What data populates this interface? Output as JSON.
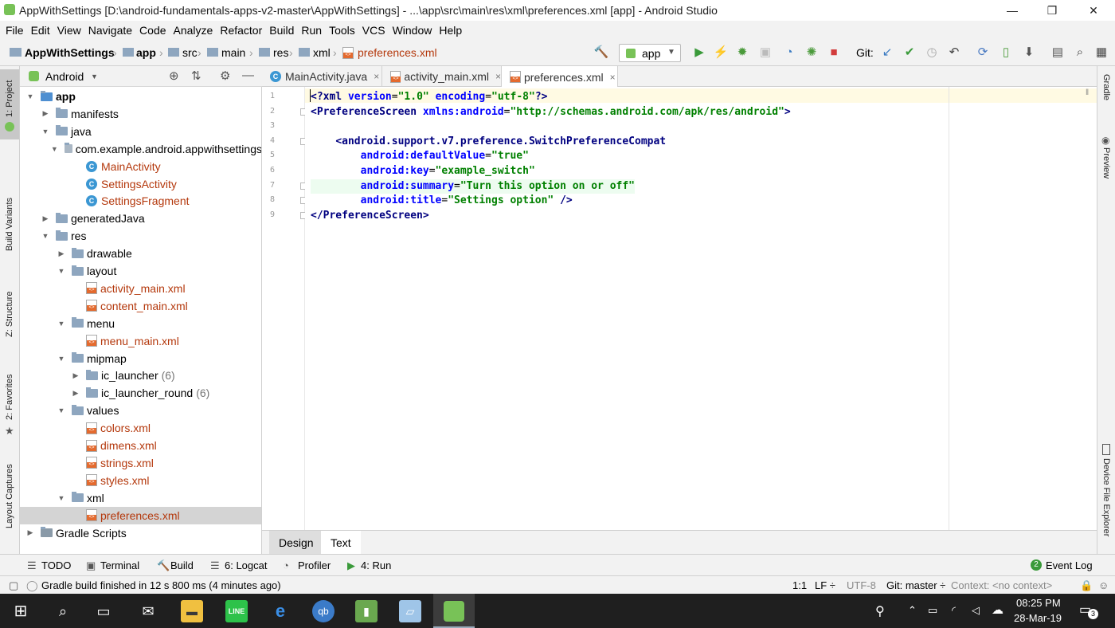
{
  "window": {
    "title": "AppWithSettings [D:\\android-fundamentals-apps-v2-master\\AppWithSettings] - ...\\app\\src\\main\\res\\xml\\preferences.xml [app] - Android Studio",
    "minimize": "—",
    "maximize": "❐",
    "close": "✕"
  },
  "menu": [
    "File",
    "Edit",
    "View",
    "Navigate",
    "Code",
    "Analyze",
    "Refactor",
    "Build",
    "Run",
    "Tools",
    "VCS",
    "Window",
    "Help"
  ],
  "breadcrumbs": [
    "AppWithSettings",
    "app",
    "src",
    "main",
    "res",
    "xml",
    "preferences.xml"
  ],
  "toolbar": {
    "run_config": "app",
    "git_label": "Git:"
  },
  "left_tabs": [
    "1: Project",
    "Build Variants",
    "Z: Structure",
    "2: Favorites",
    "Layout Captures"
  ],
  "right_tabs": [
    "Gradle",
    "Preview",
    "Device File Explorer"
  ],
  "project": {
    "view_label": "Android",
    "tree": [
      {
        "label": "app",
        "kind": "module",
        "level": 0,
        "open": true
      },
      {
        "label": "manifests",
        "kind": "folder",
        "level": 1,
        "open": false
      },
      {
        "label": "java",
        "kind": "folder",
        "level": 1,
        "open": true
      },
      {
        "label": "com.example.android.appwithsettings",
        "kind": "package",
        "level": 2,
        "open": true
      },
      {
        "label": "MainActivity",
        "kind": "class",
        "level": 3
      },
      {
        "label": "SettingsActivity",
        "kind": "class",
        "level": 3
      },
      {
        "label": "SettingsFragment",
        "kind": "class",
        "level": 3
      },
      {
        "label": "generatedJava",
        "kind": "folder",
        "level": 1,
        "open": false
      },
      {
        "label": "res",
        "kind": "folder",
        "level": 1,
        "open": true
      },
      {
        "label": "drawable",
        "kind": "folder",
        "level": 2,
        "open": false
      },
      {
        "label": "layout",
        "kind": "folder",
        "level": 2,
        "open": true
      },
      {
        "label": "activity_main.xml",
        "kind": "xml",
        "level": 3
      },
      {
        "label": "content_main.xml",
        "kind": "xml",
        "level": 3
      },
      {
        "label": "menu",
        "kind": "folder",
        "level": 2,
        "open": true
      },
      {
        "label": "menu_main.xml",
        "kind": "xml",
        "level": 3
      },
      {
        "label": "mipmap",
        "kind": "folder",
        "level": 2,
        "open": true
      },
      {
        "label": "ic_launcher",
        "kind": "folder",
        "level": 3,
        "open": false,
        "count": "(6)"
      },
      {
        "label": "ic_launcher_round",
        "kind": "folder",
        "level": 3,
        "open": false,
        "count": "(6)"
      },
      {
        "label": "values",
        "kind": "folder",
        "level": 2,
        "open": true
      },
      {
        "label": "colors.xml",
        "kind": "xml",
        "level": 3
      },
      {
        "label": "dimens.xml",
        "kind": "xml",
        "level": 3
      },
      {
        "label": "strings.xml",
        "kind": "xml",
        "level": 3
      },
      {
        "label": "styles.xml",
        "kind": "xml",
        "level": 3
      },
      {
        "label": "xml",
        "kind": "folder",
        "level": 2,
        "open": true
      },
      {
        "label": "preferences.xml",
        "kind": "xml",
        "level": 3,
        "selected": true
      },
      {
        "label": "Gradle Scripts",
        "kind": "gradle",
        "level": 0,
        "open": false
      }
    ]
  },
  "editor_tabs": [
    {
      "label": "MainActivity.java",
      "icon": "class",
      "active": false
    },
    {
      "label": "activity_main.xml",
      "icon": "xml",
      "active": false
    },
    {
      "label": "preferences.xml",
      "icon": "xml",
      "active": true
    }
  ],
  "code_lines": [
    {
      "n": "1",
      "tokens": [
        {
          "c": "kw",
          "t": "<?xml "
        },
        {
          "c": "at",
          "t": "version"
        },
        {
          "c": "",
          "t": "="
        },
        {
          "c": "st",
          "t": "\"1.0\""
        },
        {
          "c": "",
          "t": " "
        },
        {
          "c": "at",
          "t": "encoding"
        },
        {
          "c": "",
          "t": "="
        },
        {
          "c": "st",
          "t": "\"utf-8\""
        },
        {
          "c": "kw",
          "t": "?>"
        }
      ]
    },
    {
      "n": "2",
      "tokens": [
        {
          "c": "kw",
          "t": "<PreferenceScreen "
        },
        {
          "c": "at",
          "t": "xmlns:android"
        },
        {
          "c": "",
          "t": "="
        },
        {
          "c": "st",
          "t": "\"http://schemas.android.com/apk/res/android\""
        },
        {
          "c": "kw",
          "t": ">"
        }
      ]
    },
    {
      "n": "3",
      "tokens": []
    },
    {
      "n": "4",
      "tokens": [
        {
          "c": "",
          "t": "    "
        },
        {
          "c": "kw",
          "t": "<android.support.v7.preference.SwitchPreferenceCompat"
        }
      ]
    },
    {
      "n": "5",
      "tokens": [
        {
          "c": "",
          "t": "        "
        },
        {
          "c": "at",
          "t": "android:defaultValue"
        },
        {
          "c": "",
          "t": "="
        },
        {
          "c": "st",
          "t": "\"true\""
        }
      ]
    },
    {
      "n": "6",
      "tokens": [
        {
          "c": "",
          "t": "        "
        },
        {
          "c": "at",
          "t": "android:key"
        },
        {
          "c": "",
          "t": "="
        },
        {
          "c": "st",
          "t": "\"example_switch\""
        }
      ]
    },
    {
      "n": "7",
      "tokens": [
        {
          "c": "",
          "t": "        "
        },
        {
          "c": "at",
          "t": "android:summary"
        },
        {
          "c": "",
          "t": "="
        },
        {
          "c": "st",
          "t": "\"Turn this option on or off\""
        }
      ]
    },
    {
      "n": "8",
      "tokens": [
        {
          "c": "",
          "t": "        "
        },
        {
          "c": "at",
          "t": "android:title"
        },
        {
          "c": "",
          "t": "="
        },
        {
          "c": "st",
          "t": "\"Settings option\""
        },
        {
          "c": "",
          "t": " "
        },
        {
          "c": "kw",
          "t": "/>"
        }
      ]
    },
    {
      "n": "9",
      "tokens": [
        {
          "c": "kw",
          "t": "</PreferenceScreen>"
        }
      ]
    }
  ],
  "design_tabs": {
    "design": "Design",
    "text": "Text"
  },
  "tool_windows": [
    {
      "label": "TODO"
    },
    {
      "label": "Terminal"
    },
    {
      "label": "Build"
    },
    {
      "label": "6: Logcat"
    },
    {
      "label": "Profiler"
    },
    {
      "label": "4: Run"
    }
  ],
  "event_log": {
    "label": "Event Log",
    "count": "2"
  },
  "status": {
    "message": "Gradle build finished in 12 s 800 ms (4 minutes ago)",
    "position": "1:1",
    "line_sep": "LF ÷",
    "encoding": "UTF-8",
    "git": "Git: master ÷",
    "context": "Context: <no context>"
  },
  "taskbar": {
    "time": "08:25 PM",
    "date": "28-Mar-19",
    "notif_count": "3"
  }
}
